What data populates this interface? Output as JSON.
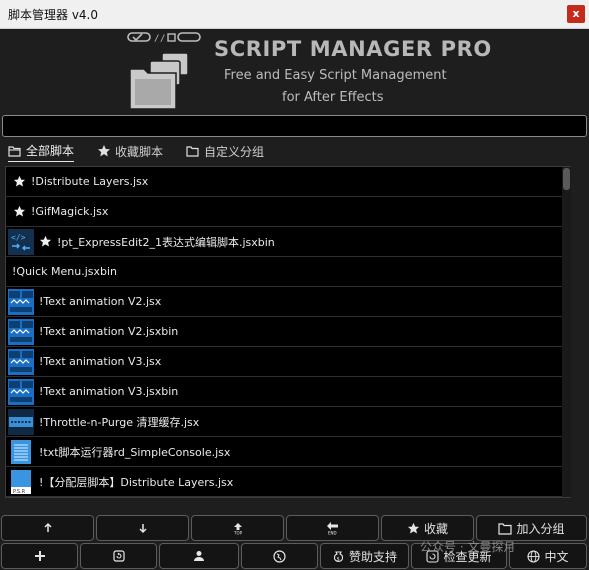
{
  "window": {
    "title": "脚本管理器 v4.0",
    "close_label": "x"
  },
  "header": {
    "brand": "SCRIPT MANAGER PRO",
    "tagline_line1": "Free and Easy Script Management",
    "tagline_line2": "for After Effects"
  },
  "search": {
    "value": "",
    "placeholder": ""
  },
  "tabs": [
    {
      "label": "全部脚本",
      "icon": "folder-open-icon",
      "active": true
    },
    {
      "label": "收藏脚本",
      "icon": "star-icon",
      "active": false
    },
    {
      "label": "自定义分组",
      "icon": "folder-icon",
      "active": false
    }
  ],
  "scripts": [
    {
      "name": "!Distribute Layers.jsx",
      "favorite": true,
      "thumb": ""
    },
    {
      "name": "!GifMagick.jsx",
      "favorite": true,
      "thumb": ""
    },
    {
      "name": "!pt_ExpressEdit2_1表达式编辑脚本.jsxbin",
      "favorite": true,
      "thumb": "code-thumbnail"
    },
    {
      "name": "!Quick Menu.jsxbin",
      "favorite": false,
      "thumb": ""
    },
    {
      "name": "!Text animation V2.jsx",
      "favorite": false,
      "thumb": "text-anim-thumbnail"
    },
    {
      "name": "!Text animation V2.jsxbin",
      "favorite": false,
      "thumb": "text-anim-thumbnail"
    },
    {
      "name": "!Text animation V3.jsx",
      "favorite": false,
      "thumb": "text-anim-thumbnail"
    },
    {
      "name": "!Text animation V3.jsxbin",
      "favorite": false,
      "thumb": "text-anim-thumbnail"
    },
    {
      "name": "!Throttle-n-Purge 清理缓存.jsx",
      "favorite": false,
      "thumb": "purge-thumbnail"
    },
    {
      "name": "!txt脚本运行器rd_SimpleConsole.jsx",
      "favorite": false,
      "thumb": "doc-thumbnail"
    },
    {
      "name": "!【分配层脚本】Distribute Layers.jsx",
      "favorite": false,
      "thumb": "file-thumbnail"
    }
  ],
  "toolbar1": {
    "favorite_label": "收藏",
    "add_group_label": "加入分组"
  },
  "toolbar2": {
    "donate_label": "赞助支持",
    "check_update_label": "检查更新",
    "language_label": "中文"
  },
  "watermark": "公众号 · 文曼探月",
  "colors": {
    "accent_blue": "#1a7fd4",
    "close_red": "#c42b1c",
    "background": "#1e1e1e"
  }
}
